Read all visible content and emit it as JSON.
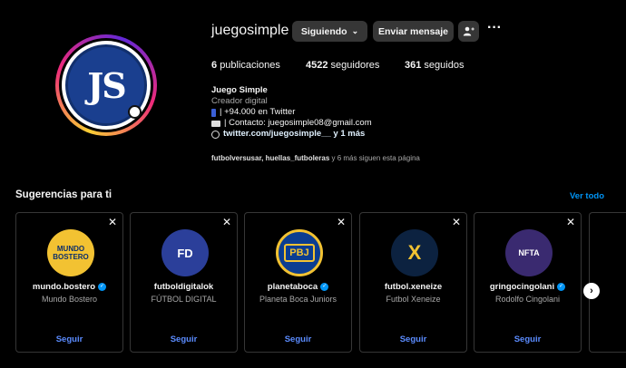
{
  "profile": {
    "username": "juegosimple",
    "avatar_text": "JS",
    "follow_button": "Siguiendo",
    "message_button": "Enviar mensaje",
    "stats": {
      "posts_count": "6",
      "posts_label": "publicaciones",
      "followers_count": "4522",
      "followers_label": "seguidores",
      "following_count": "361",
      "following_label": "seguidos"
    },
    "bio": {
      "name": "Juego Simple",
      "category": "Creador digital",
      "line1": "| +94.000 en Twitter",
      "line2": "| Contacto: juegosimple08@gmail.com",
      "link": "twitter.com/juegosimple__ y 1 más"
    },
    "mutual": {
      "names": "futbolversusar, huellas_futboleras",
      "rest": " y 6 más siguen esta página"
    }
  },
  "suggestions": {
    "title": "Sugerencias para ti",
    "see_all": "Ver todo",
    "follow_label": "Seguir",
    "items": [
      {
        "username": "mundo.bostero",
        "subtitle": "Mundo Bostero",
        "verified": true,
        "avatar_text": "MUNDO BOSTERO"
      },
      {
        "username": "futboldigitalok",
        "subtitle": "FÚTBOL DIGITAL",
        "verified": false,
        "avatar_text": "FD"
      },
      {
        "username": "planetaboca",
        "subtitle": "Planeta Boca Juniors",
        "verified": true,
        "avatar_text": "PBJ"
      },
      {
        "username": "futbol.xeneize",
        "subtitle": "Futbol Xeneize",
        "verified": false,
        "avatar_text": "X"
      },
      {
        "username": "gringocingolani",
        "subtitle": "Rodolfo Cingolani",
        "verified": true,
        "avatar_text": "NFTA"
      }
    ]
  },
  "icons": {
    "chevron": "chevron-down-icon",
    "add_user": "add-user-icon",
    "more": "more-options-icon",
    "close": "close-icon",
    "verified": "verified-icon",
    "next": "chevron-right-icon"
  },
  "colors": {
    "background": "#000000",
    "button": "#363636",
    "link_blue": "#0095f6",
    "secondary_text": "#a8a8a8"
  }
}
